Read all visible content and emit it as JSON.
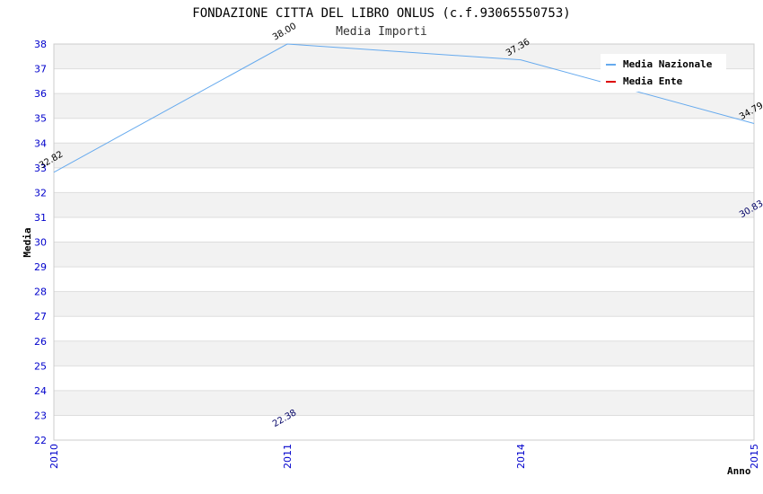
{
  "chart_data": {
    "type": "line",
    "title": "FONDAZIONE CITTA DEL LIBRO ONLUS (c.f.93065550753)",
    "subtitle": "Media Importi",
    "xlabel": "Anno",
    "ylabel": "Media",
    "x": [
      "2010",
      "2011",
      "2014",
      "2015"
    ],
    "ylim": [
      22,
      38
    ],
    "yticks": [
      "22",
      "23",
      "24",
      "25",
      "26",
      "27",
      "28",
      "29",
      "30",
      "31",
      "32",
      "33",
      "34",
      "35",
      "36",
      "37",
      "38"
    ],
    "grid": true,
    "legend_position": "top-right",
    "series": [
      {
        "name": "Media Nazionale",
        "color": "#66aaee",
        "values": [
          32.82,
          38.0,
          37.36,
          34.79
        ],
        "labels": [
          "32.82",
          "38.00",
          "37.36",
          "34.79"
        ],
        "line": true
      },
      {
        "name": "Media Ente",
        "color": "#dd0000",
        "values": [
          null,
          22.38,
          null,
          30.83
        ],
        "labels": [
          "",
          "22.38",
          "",
          "30.83"
        ],
        "line": false
      }
    ]
  }
}
